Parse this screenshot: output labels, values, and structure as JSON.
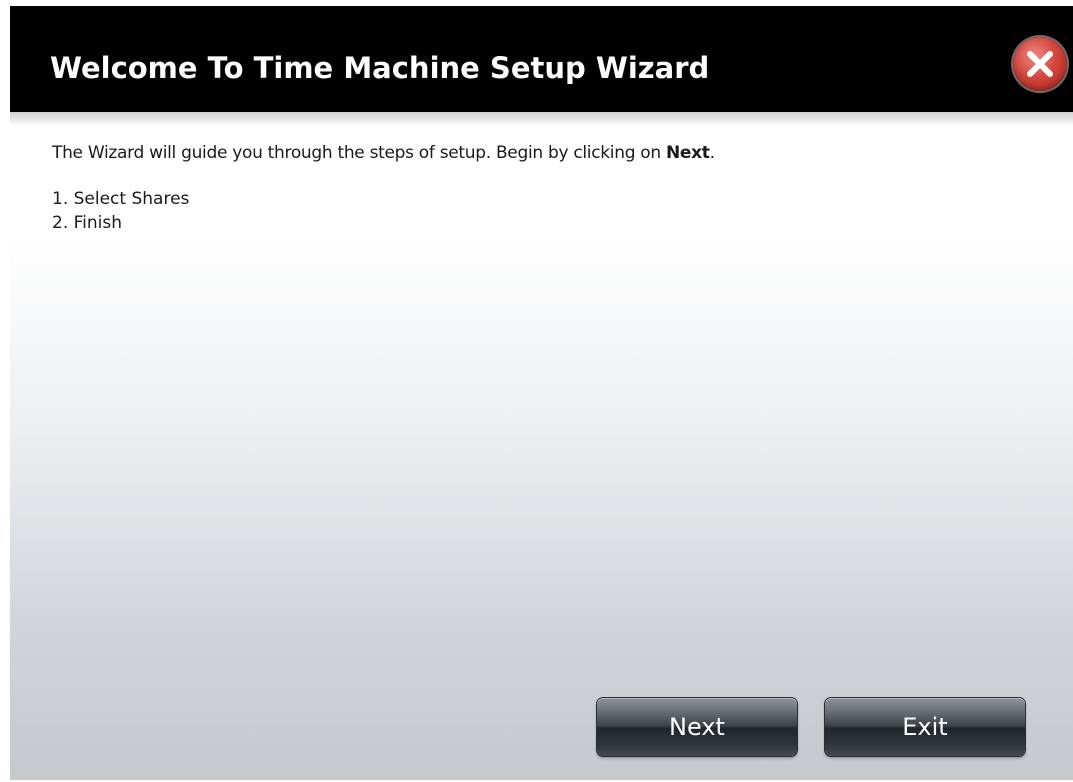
{
  "dialog": {
    "title": "Welcome To Time Machine Setup Wizard",
    "close_icon": "close-icon",
    "close_color": "#c8372d"
  },
  "content": {
    "intro_text": "The Wizard will guide you through the steps of setup. Begin by clicking on ",
    "intro_bold": "Next",
    "intro_end": ".",
    "steps": [
      "1. Select Shares",
      "2. Finish"
    ]
  },
  "buttons": {
    "next_label": "Next",
    "exit_label": "Exit"
  }
}
